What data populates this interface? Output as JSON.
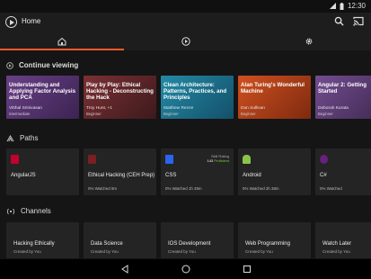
{
  "status_bar": {
    "time": "12:30"
  },
  "app_bar": {
    "title": "Home"
  },
  "tabs": [
    {
      "name": "home",
      "active": true
    },
    {
      "name": "play",
      "active": false
    },
    {
      "name": "settings",
      "active": false
    }
  ],
  "continue_viewing": {
    "heading": "Continue viewing",
    "cards": [
      {
        "title": "Understanding and Applying Factor Analysis and PCA",
        "author": "Vitthal Srinivasan",
        "level": "Intermediate",
        "color": "#4b2f63"
      },
      {
        "title": "Play by Play: Ethical Hacking - Deconstructing the Hack",
        "author": "Troy Hunt, +1",
        "level": "Beginner",
        "color": "#5b2527"
      },
      {
        "title": "Clean Architecture: Patterns, Practices, and Principles",
        "author": "Matthew Renze",
        "level": "Beginner",
        "color": "#1d6a82"
      },
      {
        "title": "Alan Turing's Wonderful Machine",
        "author": "Dan Sullivan",
        "level": "Beginner",
        "color": "#b13a16"
      },
      {
        "title": "Angular 2: Getting Started",
        "author": "Deborah Kurata",
        "level": "Beginner",
        "color": "#5b3a72"
      }
    ]
  },
  "paths": {
    "heading": "Paths",
    "cards": [
      {
        "name": "AngularJS",
        "watched": "",
        "icon": "angular-icon",
        "icon_color": "#c3002f"
      },
      {
        "name": "Ethical Hacking (CEH Prep)",
        "watched": "0% Watched 9m",
        "icon": "ceh-icon",
        "icon_color": "#7a1f22"
      },
      {
        "name": "CSS",
        "watched": "0% Watched 1h 39m",
        "icon": "css-icon",
        "icon_color": "#2965f1",
        "skill_label": "Skill Rating",
        "skill_score": "143",
        "skill_level": "Proficient"
      },
      {
        "name": "Android",
        "watched": "0% Watched 2h 38m",
        "icon": "android-icon",
        "icon_color": "#8bc34a"
      },
      {
        "name": "C#",
        "watched": "0% Watched",
        "icon": "csharp-icon",
        "icon_color": "#68217a"
      }
    ]
  },
  "channels": {
    "heading": "Channels",
    "cards": [
      {
        "name": "Hacking Ethically",
        "creator": "Created by You"
      },
      {
        "name": "Data Science",
        "creator": "Created by You"
      },
      {
        "name": "IOS Development",
        "creator": "Created by You"
      },
      {
        "name": "Web Programming",
        "creator": "Created by You"
      },
      {
        "name": "Watch Later",
        "creator": "Created by You"
      }
    ]
  },
  "colors": {
    "accent": "#f15b2a",
    "background": "#151515",
    "card": "#242424"
  }
}
